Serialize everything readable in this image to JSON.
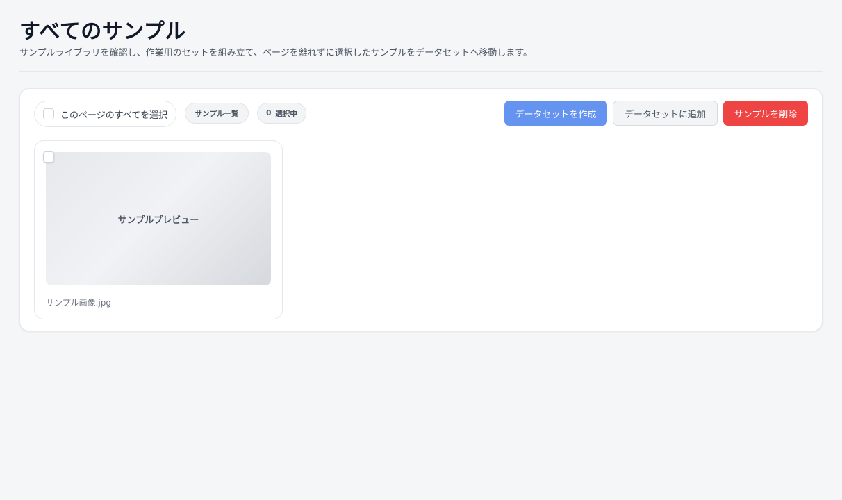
{
  "header": {
    "title": "すべてのサンプル",
    "subtitle": "サンプルライブラリを確認し、作業用のセットを組み立て、ページを離れずに選択したサンプルをデータセットへ移動します。"
  },
  "toolbar": {
    "select_all_label": "このページのすべてを選択",
    "select_all_checked": false,
    "list_pill_label": "サンプル一覧",
    "selected_count": "0",
    "selected_label": "選択中",
    "create_dataset_label": "データセットを作成",
    "add_to_dataset_label": "データセットに追加",
    "delete_samples_label": "サンプルを削除"
  },
  "colors": {
    "primary": "#6594f0",
    "danger": "#ef4444",
    "background": "#f5f6f8"
  },
  "samples": [
    {
      "preview_label": "サンプルプレビュー",
      "filename": "サンプル画像.jpg",
      "checked": false
    }
  ]
}
